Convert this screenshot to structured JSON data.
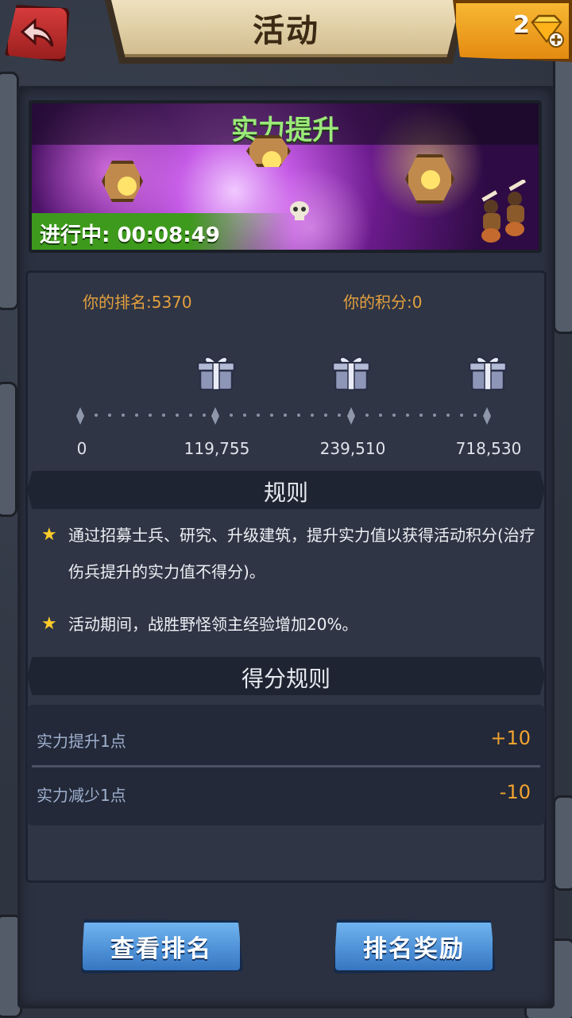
{
  "header": {
    "title": "活动",
    "back_icon": "back-arrow-icon",
    "gem_count": "2",
    "gem_icon": "gem-plus-icon"
  },
  "banner": {
    "title": "实力提升",
    "status": "进行中: 00:08:49"
  },
  "progress": {
    "rank_label": "你的排名:5370",
    "score_label": "你的积分:0",
    "milestones": [
      "0",
      "119,755",
      "239,510",
      "718,530"
    ]
  },
  "rules": {
    "title": "规则",
    "items": [
      "通过招募士兵、研究、升级建筑，提升实力值以获得活动积分(治疗伤兵提升的实力值不得分)。",
      "活动期间，战胜野怪领主经验增加20%。"
    ]
  },
  "scoring": {
    "title": "得分规则",
    "rows": [
      {
        "label": "实力提升1点",
        "value": "+10"
      },
      {
        "label": "实力减少1点",
        "value": "-10"
      }
    ]
  },
  "buttons": {
    "view_ranking": "查看排名",
    "ranking_rewards": "排名奖励"
  },
  "colors": {
    "accent_orange": "#e3a03e",
    "banner_title_green": "#9be87a",
    "status_green": "#3e9a1c",
    "button_blue": "#3676c2"
  }
}
